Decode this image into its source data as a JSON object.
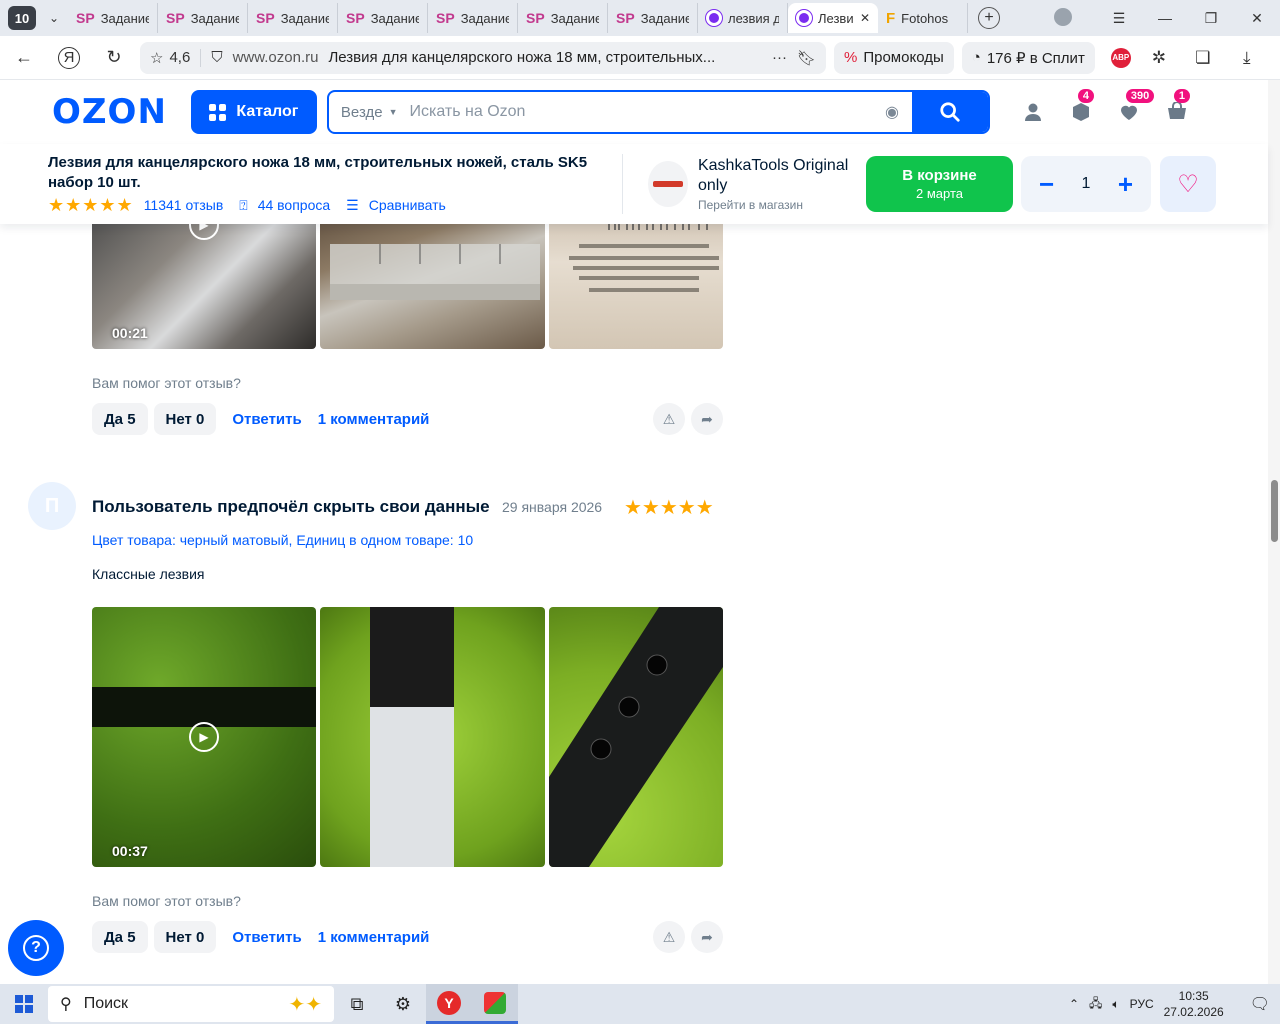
{
  "browser": {
    "tab_count": "10",
    "tabs": [
      {
        "icon": "SP",
        "title": "Задание"
      },
      {
        "icon": "SP",
        "title": "Задание"
      },
      {
        "icon": "SP",
        "title": "Задание"
      },
      {
        "icon": "SP",
        "title": "Задание"
      },
      {
        "icon": "SP",
        "title": "Задание"
      },
      {
        "icon": "SP",
        "title": "Задание"
      },
      {
        "icon": "SP",
        "title": "Задание"
      },
      {
        "icon": "ozon",
        "title": "лезвия д"
      },
      {
        "icon": "ozon",
        "title": "Лезви",
        "active": true
      },
      {
        "icon": "F",
        "title": "Fotohos"
      }
    ],
    "rating": "4,6",
    "domain": "www.ozon.ru",
    "page_title": "Лезвия для канцелярского ножа 18 мм, строительных...",
    "promo_label": "Промокоды",
    "split_label": "176 ₽ в Сплит",
    "abp_label": "ABP"
  },
  "header": {
    "logo": "OZON",
    "catalog_label": "Каталог",
    "search_scope": "Везде",
    "search_placeholder": "Искать на Ozon",
    "badges": {
      "orders": "4",
      "favorites": "390",
      "cart": "1"
    }
  },
  "sticky": {
    "product_name": "Лезвия для канцелярского ножа 18 мм, строительных ножей, сталь SK5 набор 10 шт.",
    "reviews": "11341 отзыв",
    "questions": "44 вопроса",
    "compare": "Сравнивать",
    "shop_name": "KashkaTools Original only",
    "shop_link": "Перейти в магазин",
    "cart_label": "В корзине",
    "cart_sub": "2 марта",
    "quantity": "1"
  },
  "review1": {
    "video_time": "00:21",
    "helpful_q": "Вам помог этот отзыв?",
    "yes": "Да 5",
    "no": "Нет 0",
    "reply": "Ответить",
    "comments": "1 комментарий"
  },
  "review2": {
    "avatar_letter": "П",
    "author": "Пользователь предпочёл скрыть свои данные",
    "date": "29 января 2026",
    "rating": 5,
    "variant": "Цвет товара: черный матовый, Единиц в одном товаре: 10",
    "text": "Классные лезвия",
    "video_time": "00:37",
    "helpful_q": "Вам помог этот отзыв?",
    "yes": "Да 5",
    "no": "Нет 0",
    "reply": "Ответить",
    "comments": "1 комментарий"
  },
  "taskbar": {
    "search_label": "Поиск",
    "lang": "РУС",
    "time": "10:35",
    "date": "27.02.2026"
  }
}
